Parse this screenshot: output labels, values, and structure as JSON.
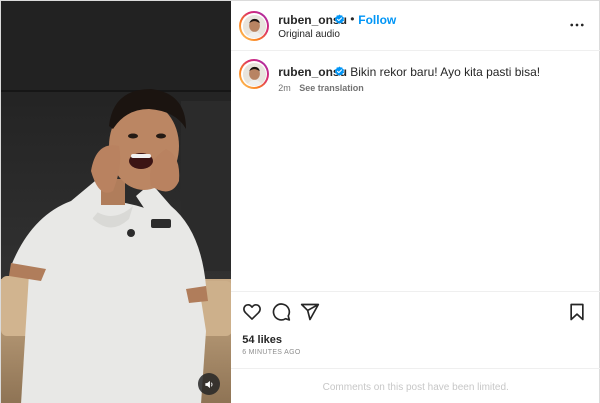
{
  "post": {
    "author": {
      "username": "ruben_onsu",
      "verified": true,
      "follow_label": "Follow",
      "separator": "•",
      "audio_label": "Original audio"
    },
    "caption": {
      "username": "ruben_onsu",
      "text": "Bikin rekor baru! Ayo kita pasti bisa!",
      "time": "2m",
      "see_translation": "See translation"
    },
    "actions": {
      "like_icon": "heart-icon",
      "comment_icon": "comment-icon",
      "share_icon": "share-icon",
      "save_icon": "bookmark-icon"
    },
    "likes_text": "54 likes",
    "posted_ago": "6 MINUTES AGO",
    "comments_limited": "Comments on this post have been limited."
  },
  "colors": {
    "accent": "#0095f6",
    "verified": "#0095f6",
    "muted": "#737373"
  }
}
